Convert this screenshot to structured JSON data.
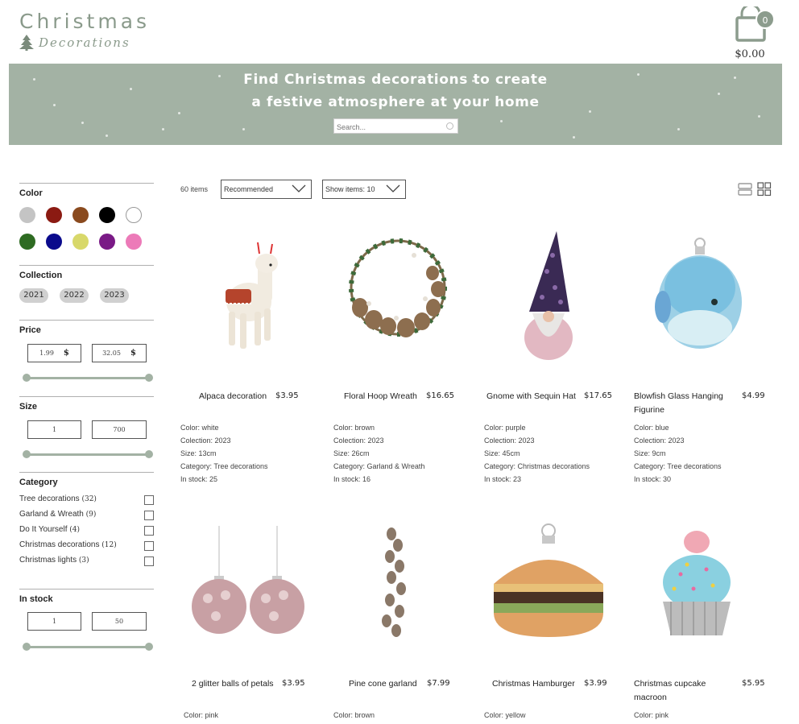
{
  "header": {
    "logo_title": "Christmas",
    "logo_subtitle": "Decorations",
    "cart_count": "0",
    "cart_total": "$0.00"
  },
  "banner": {
    "line1": "Find Christmas decorations to create",
    "line2": "a festive atmosphere at your home",
    "search_placeholder": "Search..."
  },
  "filters": {
    "color_title": "Color",
    "colors": [
      "#c4c4c4",
      "#8b1a12",
      "#8a4a1e",
      "#000000",
      "#ffffff",
      "#2e6b22",
      "#0a0a8c",
      "#d8d86a",
      "#7a1a86",
      "#ec7ab8"
    ],
    "collection_title": "Collection",
    "collections": [
      "2021",
      "2022",
      "2023"
    ],
    "price_title": "Price",
    "price_min": "1.99",
    "price_max": "32.05",
    "currency": "$",
    "size_title": "Size",
    "size_min": "1",
    "size_max": "700",
    "category_title": "Category",
    "categories": [
      {
        "name": "Tree decorations",
        "count": "(32)"
      },
      {
        "name": "Garland & Wreath",
        "count": "(9)"
      },
      {
        "name": "Do It Yourself",
        "count": "(4)"
      },
      {
        "name": "Christmas decorations",
        "count": "(12)"
      },
      {
        "name": "Christmas lights",
        "count": "(3)"
      }
    ],
    "stock_title": "In stock",
    "stock_min": "1",
    "stock_max": "50"
  },
  "toolbar": {
    "items_count": "60 items",
    "sort_value": "Recommended",
    "show_value": "Show items: 10"
  },
  "products": [
    {
      "name": "Alpaca decoration",
      "price": "$3.95",
      "color": "Color: white",
      "collection": "Colection: 2023",
      "size": "Size: 13cm",
      "category": "Category: Tree decorations",
      "stock": "In stock: 25"
    },
    {
      "name": "Floral Hoop Wreath",
      "price": "$16.65",
      "color": "Color: brown",
      "collection": "Colection: 2023",
      "size": "Size: 26cm",
      "category": "Category: Garland & Wreath",
      "stock": "In stock: 16"
    },
    {
      "name": "Gnome with Sequin Hat",
      "price": "$17.65",
      "color": "Color: purple",
      "collection": "Colection: 2023",
      "size": "Size: 45cm",
      "category": "Category: Christmas decorations",
      "stock": "In stock: 23"
    },
    {
      "name": "Blowfish Glass Hanging Figurine",
      "price": "$4.99",
      "color": "Color: blue",
      "collection": "Colection: 2023",
      "size": "Size: 9cm",
      "category": "Category: Tree decorations",
      "stock": "In stock: 30"
    },
    {
      "name": "2 glitter balls of petals",
      "price": "$3.95",
      "color": "Color: pink"
    },
    {
      "name": "Pine cone garland",
      "price": "$7.99",
      "color": "Color: brown"
    },
    {
      "name": "Christmas Hamburger",
      "price": "$3.99",
      "color": "Color: yellow"
    },
    {
      "name": "Christmas cupcake macroon",
      "price": "$5.95",
      "color": "Color: pink"
    }
  ]
}
